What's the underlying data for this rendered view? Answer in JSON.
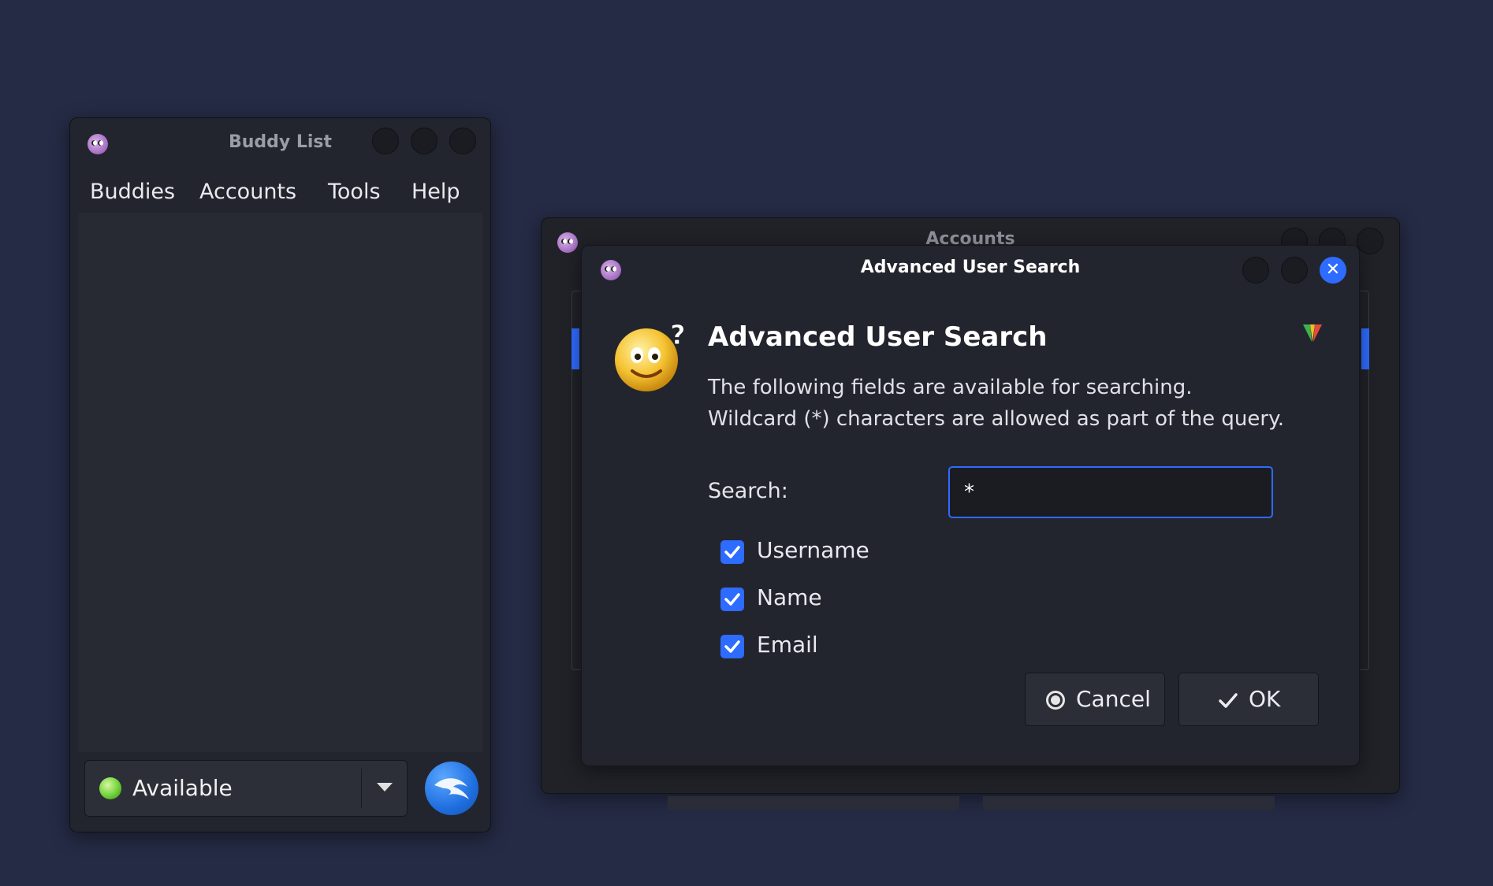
{
  "buddy_list": {
    "title": "Buddy List",
    "menu": [
      "Buddies",
      "Accounts",
      "Tools",
      "Help"
    ],
    "status": "Available"
  },
  "accounts_window": {
    "title": "Accounts"
  },
  "search_dialog": {
    "title": "Advanced User Search",
    "heading": "Advanced User Search",
    "description_line1": "The following fields are available for searching.",
    "description_line2": "Wildcard (*) characters are allowed as part of the query.",
    "search_label": "Search:",
    "search_value": "*",
    "fields": [
      {
        "label": "Username",
        "checked": true
      },
      {
        "label": "Name",
        "checked": true
      },
      {
        "label": "Email",
        "checked": true
      }
    ],
    "cancel_label": "Cancel",
    "ok_label": "OK"
  },
  "colors": {
    "desktop": "#252b45",
    "accent": "#2e6bff",
    "window": "#23252e"
  },
  "icons": [
    "pidgin-icon",
    "smiley-question-icon",
    "status-available-icon",
    "kali-dragon-icon",
    "cancel-icon",
    "checkmark-icon",
    "close-icon"
  ]
}
